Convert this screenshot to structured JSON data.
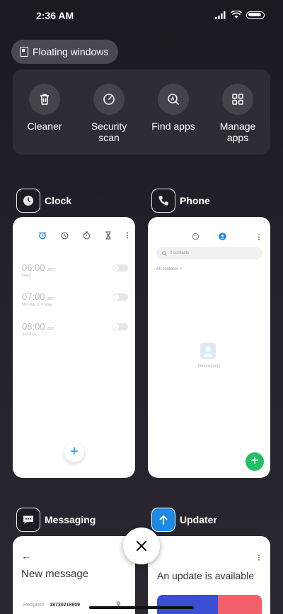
{
  "status_bar": {
    "time": "2:36 AM"
  },
  "floating_windows": {
    "label": "Floating windows"
  },
  "tools": [
    {
      "label": "Cleaner",
      "icon": "trash-icon"
    },
    {
      "label": "Security scan",
      "icon": "gauge-icon"
    },
    {
      "label": "Find apps",
      "icon": "search-app-icon"
    },
    {
      "label": "Manage apps",
      "icon": "grid-icon"
    }
  ],
  "apps": {
    "clock": {
      "title": "Clock",
      "alarms": [
        {
          "time": "06:00",
          "ampm": "am",
          "repeat": "Daily"
        },
        {
          "time": "07:00",
          "ampm": "am",
          "repeat": "Monday to Friday"
        },
        {
          "time": "08:00",
          "ampm": "am",
          "repeat": "Sat-Sun"
        }
      ]
    },
    "phone": {
      "title": "Phone",
      "search_placeholder": "0 contacts",
      "filter": "All contacts",
      "empty_label": "No contacts"
    },
    "messaging": {
      "title": "Messaging",
      "heading": "New message",
      "recipient_label": "Recipient",
      "recipient_value": "18730218809"
    },
    "updater": {
      "title": "Updater",
      "heading": "An update is available"
    }
  },
  "colors": {
    "accent_blue": "#1e88e5",
    "green": "#22c064",
    "updater_blue": "#3a4fd4",
    "updater_red": "#f3606b"
  }
}
